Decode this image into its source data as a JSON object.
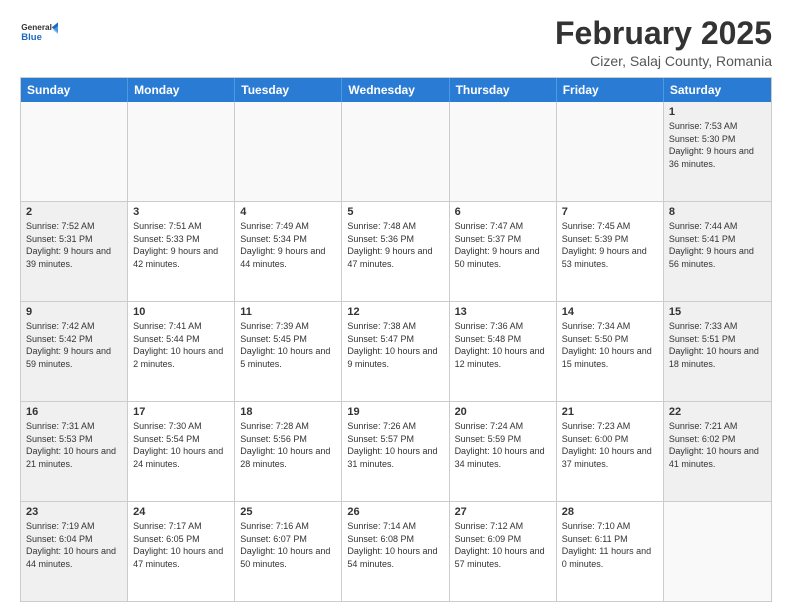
{
  "header": {
    "logo_general": "General",
    "logo_blue": "Blue",
    "month_title": "February 2025",
    "location": "Cizer, Salaj County, Romania"
  },
  "days_of_week": [
    "Sunday",
    "Monday",
    "Tuesday",
    "Wednesday",
    "Thursday",
    "Friday",
    "Saturday"
  ],
  "rows": [
    [
      {
        "day": "",
        "text": "",
        "empty": true
      },
      {
        "day": "",
        "text": "",
        "empty": true
      },
      {
        "day": "",
        "text": "",
        "empty": true
      },
      {
        "day": "",
        "text": "",
        "empty": true
      },
      {
        "day": "",
        "text": "",
        "empty": true
      },
      {
        "day": "",
        "text": "",
        "empty": true
      },
      {
        "day": "1",
        "text": "Sunrise: 7:53 AM\nSunset: 5:30 PM\nDaylight: 9 hours and 36 minutes.",
        "empty": false
      }
    ],
    [
      {
        "day": "2",
        "text": "Sunrise: 7:52 AM\nSunset: 5:31 PM\nDaylight: 9 hours and 39 minutes.",
        "empty": false
      },
      {
        "day": "3",
        "text": "Sunrise: 7:51 AM\nSunset: 5:33 PM\nDaylight: 9 hours and 42 minutes.",
        "empty": false
      },
      {
        "day": "4",
        "text": "Sunrise: 7:49 AM\nSunset: 5:34 PM\nDaylight: 9 hours and 44 minutes.",
        "empty": false
      },
      {
        "day": "5",
        "text": "Sunrise: 7:48 AM\nSunset: 5:36 PM\nDaylight: 9 hours and 47 minutes.",
        "empty": false
      },
      {
        "day": "6",
        "text": "Sunrise: 7:47 AM\nSunset: 5:37 PM\nDaylight: 9 hours and 50 minutes.",
        "empty": false
      },
      {
        "day": "7",
        "text": "Sunrise: 7:45 AM\nSunset: 5:39 PM\nDaylight: 9 hours and 53 minutes.",
        "empty": false
      },
      {
        "day": "8",
        "text": "Sunrise: 7:44 AM\nSunset: 5:41 PM\nDaylight: 9 hours and 56 minutes.",
        "empty": false
      }
    ],
    [
      {
        "day": "9",
        "text": "Sunrise: 7:42 AM\nSunset: 5:42 PM\nDaylight: 9 hours and 59 minutes.",
        "empty": false
      },
      {
        "day": "10",
        "text": "Sunrise: 7:41 AM\nSunset: 5:44 PM\nDaylight: 10 hours and 2 minutes.",
        "empty": false
      },
      {
        "day": "11",
        "text": "Sunrise: 7:39 AM\nSunset: 5:45 PM\nDaylight: 10 hours and 5 minutes.",
        "empty": false
      },
      {
        "day": "12",
        "text": "Sunrise: 7:38 AM\nSunset: 5:47 PM\nDaylight: 10 hours and 9 minutes.",
        "empty": false
      },
      {
        "day": "13",
        "text": "Sunrise: 7:36 AM\nSunset: 5:48 PM\nDaylight: 10 hours and 12 minutes.",
        "empty": false
      },
      {
        "day": "14",
        "text": "Sunrise: 7:34 AM\nSunset: 5:50 PM\nDaylight: 10 hours and 15 minutes.",
        "empty": false
      },
      {
        "day": "15",
        "text": "Sunrise: 7:33 AM\nSunset: 5:51 PM\nDaylight: 10 hours and 18 minutes.",
        "empty": false
      }
    ],
    [
      {
        "day": "16",
        "text": "Sunrise: 7:31 AM\nSunset: 5:53 PM\nDaylight: 10 hours and 21 minutes.",
        "empty": false
      },
      {
        "day": "17",
        "text": "Sunrise: 7:30 AM\nSunset: 5:54 PM\nDaylight: 10 hours and 24 minutes.",
        "empty": false
      },
      {
        "day": "18",
        "text": "Sunrise: 7:28 AM\nSunset: 5:56 PM\nDaylight: 10 hours and 28 minutes.",
        "empty": false
      },
      {
        "day": "19",
        "text": "Sunrise: 7:26 AM\nSunset: 5:57 PM\nDaylight: 10 hours and 31 minutes.",
        "empty": false
      },
      {
        "day": "20",
        "text": "Sunrise: 7:24 AM\nSunset: 5:59 PM\nDaylight: 10 hours and 34 minutes.",
        "empty": false
      },
      {
        "day": "21",
        "text": "Sunrise: 7:23 AM\nSunset: 6:00 PM\nDaylight: 10 hours and 37 minutes.",
        "empty": false
      },
      {
        "day": "22",
        "text": "Sunrise: 7:21 AM\nSunset: 6:02 PM\nDaylight: 10 hours and 41 minutes.",
        "empty": false
      }
    ],
    [
      {
        "day": "23",
        "text": "Sunrise: 7:19 AM\nSunset: 6:04 PM\nDaylight: 10 hours and 44 minutes.",
        "empty": false
      },
      {
        "day": "24",
        "text": "Sunrise: 7:17 AM\nSunset: 6:05 PM\nDaylight: 10 hours and 47 minutes.",
        "empty": false
      },
      {
        "day": "25",
        "text": "Sunrise: 7:16 AM\nSunset: 6:07 PM\nDaylight: 10 hours and 50 minutes.",
        "empty": false
      },
      {
        "day": "26",
        "text": "Sunrise: 7:14 AM\nSunset: 6:08 PM\nDaylight: 10 hours and 54 minutes.",
        "empty": false
      },
      {
        "day": "27",
        "text": "Sunrise: 7:12 AM\nSunset: 6:09 PM\nDaylight: 10 hours and 57 minutes.",
        "empty": false
      },
      {
        "day": "28",
        "text": "Sunrise: 7:10 AM\nSunset: 6:11 PM\nDaylight: 11 hours and 0 minutes.",
        "empty": false
      },
      {
        "day": "",
        "text": "",
        "empty": true
      }
    ]
  ]
}
